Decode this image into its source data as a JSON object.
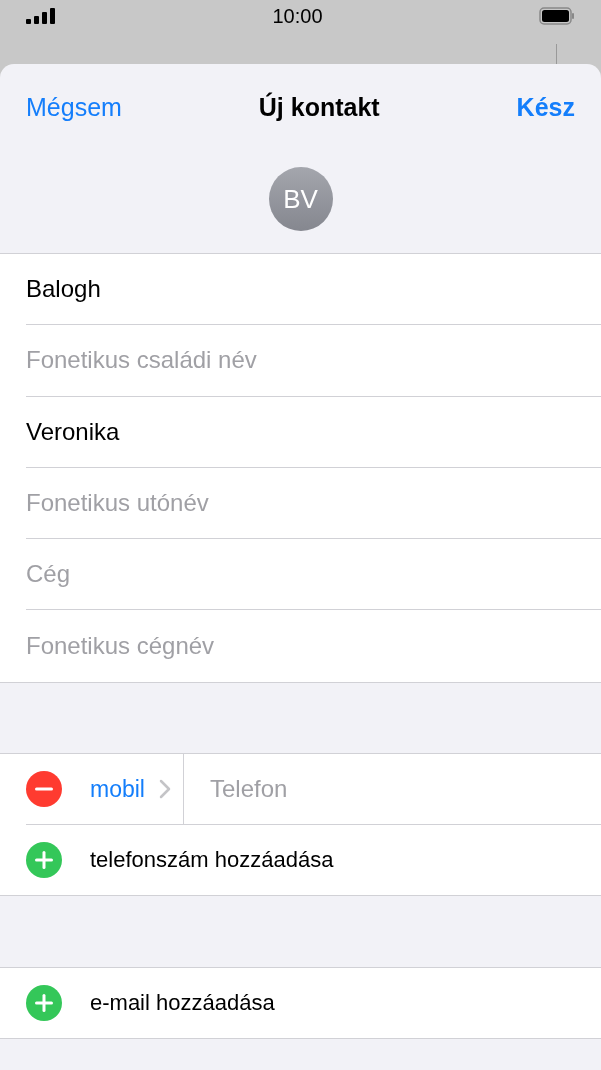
{
  "status_bar": {
    "time": "10:00"
  },
  "nav": {
    "cancel": "Mégsem",
    "title": "Új kontakt",
    "done": "Kész"
  },
  "avatar": {
    "initials": "BV"
  },
  "name_fields": [
    {
      "value": "Balogh"
    },
    {
      "placeholder": "Fonetikus családi név"
    },
    {
      "value": "Veronika"
    },
    {
      "placeholder": "Fonetikus utónév"
    },
    {
      "placeholder": "Cég"
    },
    {
      "placeholder": "Fonetikus cégnév"
    }
  ],
  "phone_section": {
    "entries": [
      {
        "label": "mobil",
        "placeholder": "Telefon"
      }
    ],
    "add": "telefonszám hozzáadása"
  },
  "email_section": {
    "add": "e-mail hozzáadása"
  }
}
